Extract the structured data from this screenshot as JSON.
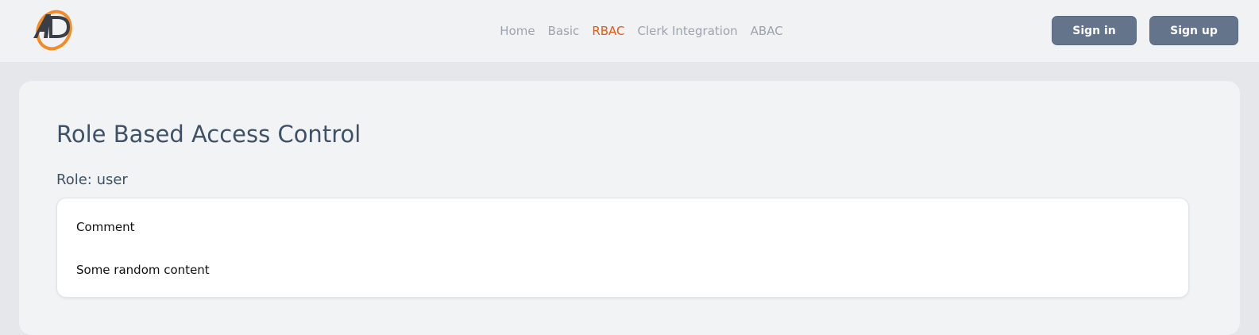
{
  "header": {
    "logo_text": "AD",
    "nav": [
      {
        "label": "Home",
        "active": false
      },
      {
        "label": "Basic",
        "active": false
      },
      {
        "label": "RBAC",
        "active": true
      },
      {
        "label": "Clerk Integration",
        "active": false
      },
      {
        "label": "ABAC",
        "active": false
      }
    ],
    "sign_in_label": "Sign in",
    "sign_up_label": "Sign up"
  },
  "main": {
    "title": "Role Based Access Control",
    "role_label": "Role: user",
    "card": {
      "title": "Comment",
      "body": "Some random content"
    }
  },
  "colors": {
    "accent": "#ea580c",
    "button": "#64748b",
    "nav_inactive": "#9ca3af",
    "heading": "#3f5166"
  }
}
